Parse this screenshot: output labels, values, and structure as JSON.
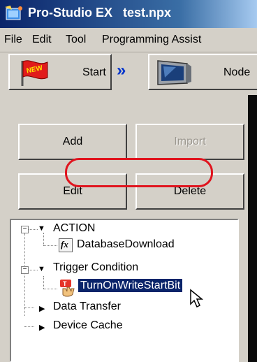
{
  "window": {
    "title": "Pro-Studio EX   test.npx"
  },
  "menu": [
    "File",
    "Edit",
    "Tool",
    "Programming Assist"
  ],
  "toolbar": {
    "start_label": "Start",
    "start_badge": "NEW",
    "node_label": "Node",
    "arrow_glyph": "»"
  },
  "buttons": {
    "add": "Add",
    "import": "Import",
    "edit": "Edit",
    "delete": "Delete"
  },
  "tree": {
    "action": {
      "label": "ACTION",
      "expander": "−"
    },
    "database_download": {
      "label": "DatabaseDownload",
      "icon_text": "fx"
    },
    "trigger_condition": {
      "label": "Trigger Condition",
      "expander": "−"
    },
    "turn_on": {
      "label": "TurnOnWriteStartBit"
    },
    "data_transfer": {
      "label": "Data Transfer"
    },
    "device_cache": {
      "label": "Device Cache"
    }
  },
  "colors": {
    "highlight": "#e0141e",
    "selection": "#0a246a",
    "titlebar": "#0a246a"
  }
}
